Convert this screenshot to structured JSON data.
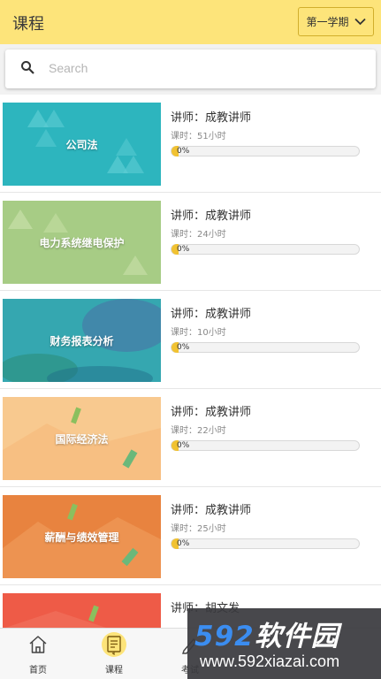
{
  "header": {
    "title": "课程",
    "term_label": "第一学期"
  },
  "search": {
    "placeholder": "Search"
  },
  "courses": [
    {
      "name": "公司法",
      "teacher": "讲师：成教讲师",
      "hours": "课时：51小时",
      "progress": "0%",
      "progress_value": 0,
      "color": "#2db5be"
    },
    {
      "name": "电力系统继电保护",
      "teacher": "讲师：成教讲师",
      "hours": "课时：24小时",
      "progress": "0%",
      "progress_value": 0,
      "color": "#a7cc85"
    },
    {
      "name": "财务报表分析",
      "teacher": "讲师：成教讲师",
      "hours": "课时：10小时",
      "progress": "0%",
      "progress_value": 0,
      "color": "#35a7b0"
    },
    {
      "name": "国际经济法",
      "teacher": "讲师：成教讲师",
      "hours": "课时：22小时",
      "progress": "0%",
      "progress_value": 0,
      "color": "#f8c98f"
    },
    {
      "name": "薪酬与绩效管理",
      "teacher": "讲师：成教讲师",
      "hours": "课时：25小时",
      "progress": "0%",
      "progress_value": 0,
      "color": "#e8833f"
    },
    {
      "name": "",
      "teacher": "讲师：胡文发",
      "hours": "",
      "progress": "",
      "color": "#ee5b47"
    }
  ],
  "tabs": [
    {
      "label": "首页",
      "icon": "home-icon"
    },
    {
      "label": "课程",
      "icon": "course-icon"
    },
    {
      "label": "考试",
      "icon": "exam-icon"
    },
    {
      "label": "",
      "icon": ""
    },
    {
      "label": "",
      "icon": ""
    }
  ],
  "watermark": {
    "brand_num": "592",
    "brand_text": "软件园",
    "url": "www.592xiazai.com"
  }
}
